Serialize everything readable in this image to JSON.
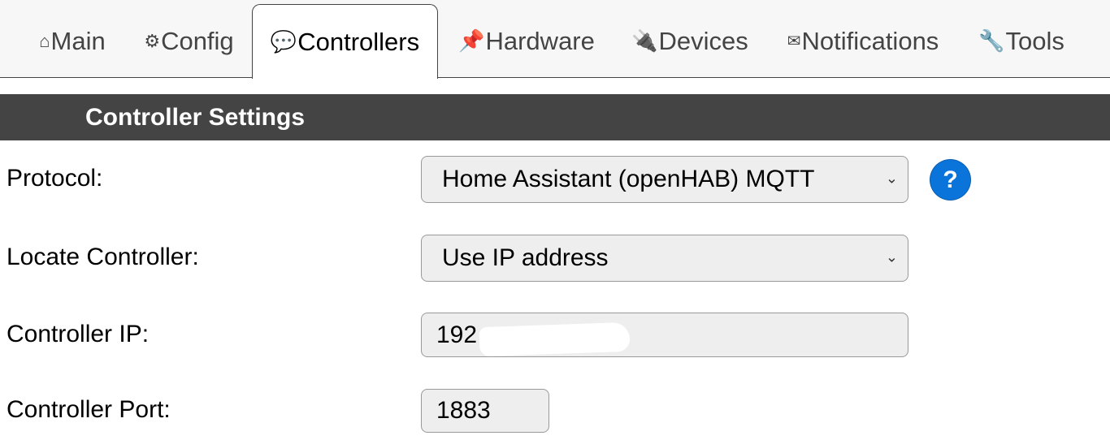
{
  "tabs": [
    {
      "icon": "⌂",
      "icon_name": "home-icon",
      "label": "Main",
      "active": false
    },
    {
      "icon": "⚙",
      "icon_name": "gear-icon",
      "label": "Config",
      "active": false
    },
    {
      "icon": "💬",
      "icon_name": "speech-bubble-icon",
      "label": "Controllers",
      "active": true
    },
    {
      "icon": "📌",
      "icon_name": "pushpin-icon",
      "label": "Hardware",
      "active": false
    },
    {
      "icon": "🔌",
      "icon_name": "plug-icon",
      "label": "Devices",
      "active": false
    },
    {
      "icon": "✉",
      "icon_name": "envelope-icon",
      "label": "Notifications",
      "active": false
    },
    {
      "icon": "🔧",
      "icon_name": "wrench-icon",
      "label": "Tools",
      "active": false
    }
  ],
  "section": {
    "title": "Controller Settings"
  },
  "form": {
    "protocol": {
      "label": "Protocol:",
      "value": "Home Assistant (openHAB) MQTT"
    },
    "help": {
      "icon": "?"
    },
    "locate": {
      "label": "Locate Controller:",
      "value": "Use IP address"
    },
    "ip": {
      "label": "Controller IP:",
      "value": "192"
    },
    "port": {
      "label": "Controller Port:",
      "value": "1883"
    }
  },
  "colors": {
    "header_bg": "#444444",
    "help_button": "#0a74da",
    "field_bg": "#eeeeee"
  }
}
